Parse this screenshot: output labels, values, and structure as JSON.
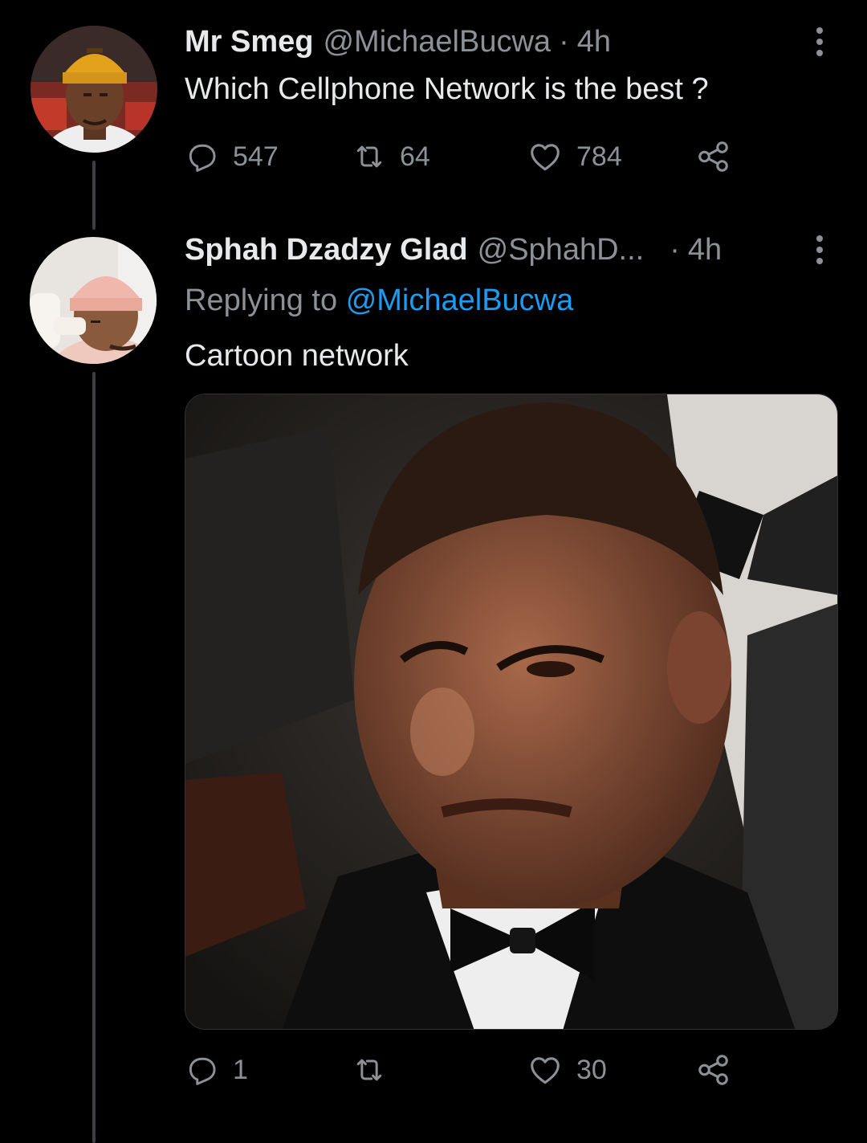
{
  "tweets": [
    {
      "display_name": "Mr Smeg",
      "handle": "@MichaelBucwa",
      "separator": "·",
      "time": "4h",
      "text": "Which Cellphone Network is the best ?",
      "replies": "547",
      "retweets": "64",
      "likes": "784"
    },
    {
      "display_name": "Sphah Dzadzy Glad",
      "handle": "@SphahD...",
      "separator": "·",
      "time": "4h",
      "replying_prefix": "Replying to",
      "replying_to": "@MichaelBucwa",
      "text": "Cartoon network",
      "replies": "1",
      "retweets": "",
      "likes": "30"
    }
  ],
  "icons": {
    "reply": "reply-icon",
    "retweet": "retweet-icon",
    "like": "like-icon",
    "share": "share-icon",
    "more": "more-vertical-icon"
  },
  "colors": {
    "background": "#000000",
    "text": "#e7e9ea",
    "secondary": "#8b9196",
    "link": "#1d9bf0",
    "thread_line": "#3b3f43"
  }
}
